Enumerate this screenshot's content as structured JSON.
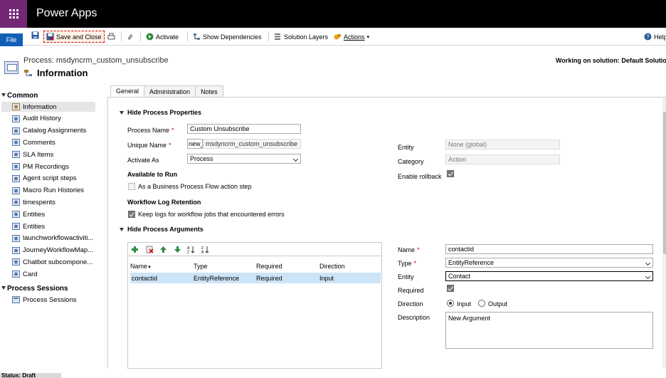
{
  "app": {
    "title": "Power Apps"
  },
  "ribbon": {
    "file": "File",
    "save_and_close": "Save and Close",
    "activate": "Activate",
    "show_dependencies": "Show Dependencies",
    "solution_layers": "Solution Layers",
    "actions": "Actions",
    "help": "Help"
  },
  "header": {
    "process_label": "Process: msdyncrm_custom_unsubscribe",
    "title": "Information",
    "working_on": "Working on solution: Default Solution"
  },
  "sidebar": {
    "common_label": "Common",
    "items": [
      "Information",
      "Audit History",
      "Catalog Assignments",
      "Comments",
      "SLA Items",
      "PM Recordings",
      "Agent script steps",
      "Macro Run Histories",
      "timespents",
      "Entities",
      "Entities",
      "launchworkflowactiviti...",
      "JourneyWorkflowMap...",
      "Chatbot subcompone...",
      "Card"
    ],
    "process_sessions_label": "Process Sessions",
    "process_sessions_item": "Process Sessions"
  },
  "tabs": [
    "General",
    "Administration",
    "Notes"
  ],
  "properties": {
    "section_title": "Hide Process Properties",
    "process_name_label": "Process Name",
    "process_name_value": "Custom Unsubscribe",
    "unique_name_label": "Unique Name",
    "unique_name_prefix": "new_",
    "unique_name_value": "msdyncrm_custom_unsubscribe",
    "activate_as_label": "Activate As",
    "activate_as_value": "Process",
    "available_to_run": "Available to Run",
    "bpf_step_label": "As a Business Process Flow action step",
    "log_retention": "Workflow Log Retention",
    "keep_logs_label": "Keep logs for workflow jobs that encountered errors",
    "entity_label": "Entity",
    "entity_value": "None (global)",
    "category_label": "Category",
    "category_value": "Action",
    "rollback_label": "Enable rollback"
  },
  "arguments": {
    "section_title": "Hide Process Arguments",
    "columns": [
      "Name",
      "Type",
      "Required",
      "Direction"
    ],
    "rows": [
      {
        "name": "contactid",
        "type": "EntityReference",
        "required": "Required",
        "direction": "Input"
      }
    ],
    "name_label": "Name",
    "name_value": "contactid",
    "type_label": "Type",
    "type_value": "EntityReference",
    "entity_label": "Entity",
    "entity_value": "Contact",
    "required_label": "Required",
    "direction_label": "Direction",
    "direction_input": "Input",
    "direction_output": "Output",
    "description_label": "Description",
    "description_value": "New Argument"
  },
  "status": {
    "text": "Status: Draft"
  }
}
